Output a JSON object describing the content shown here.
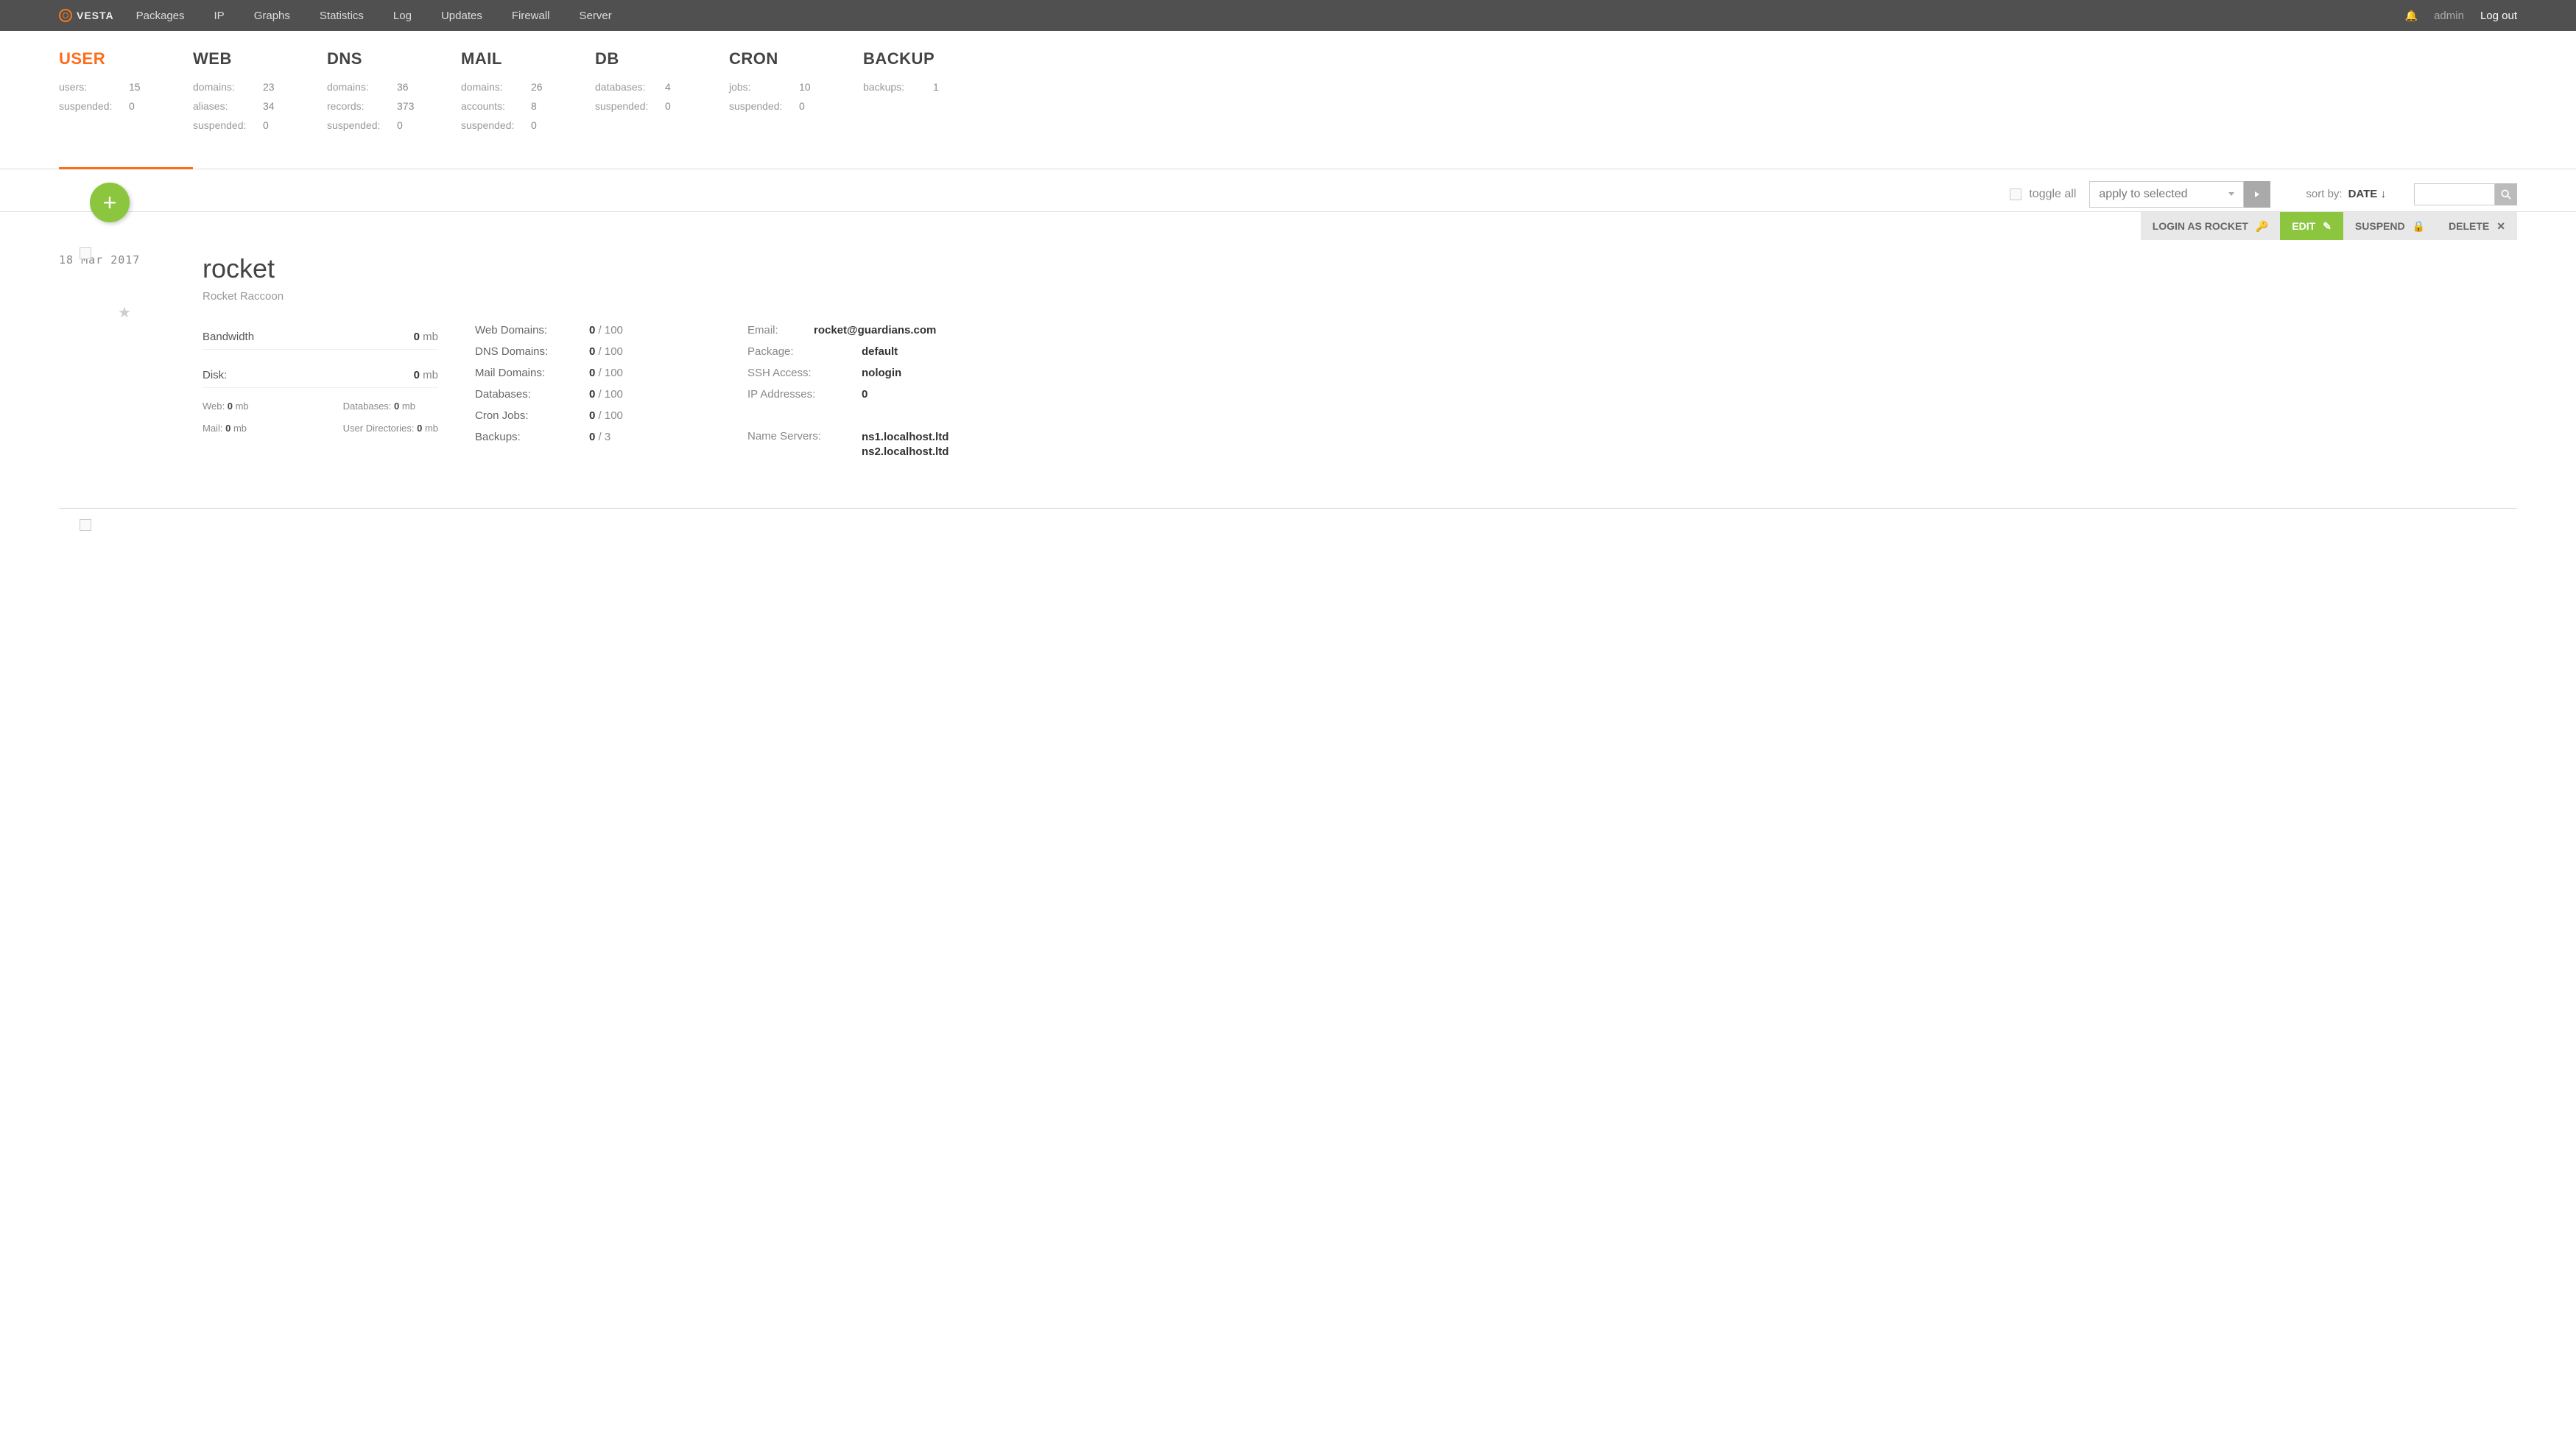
{
  "brand": "VESTA",
  "topnav": [
    "Packages",
    "IP",
    "Graphs",
    "Statistics",
    "Log",
    "Updates",
    "Firewall",
    "Server"
  ],
  "topright": {
    "admin": "admin",
    "logout": "Log out"
  },
  "tabs": [
    {
      "title": "USER",
      "lines": [
        [
          "users:",
          "15"
        ],
        [
          "suspended:",
          "0"
        ]
      ]
    },
    {
      "title": "WEB",
      "lines": [
        [
          "domains:",
          "23"
        ],
        [
          "aliases:",
          "34"
        ],
        [
          "suspended:",
          "0"
        ]
      ]
    },
    {
      "title": "DNS",
      "lines": [
        [
          "domains:",
          "36"
        ],
        [
          "records:",
          "373"
        ],
        [
          "suspended:",
          "0"
        ]
      ]
    },
    {
      "title": "MAIL",
      "lines": [
        [
          "domains:",
          "26"
        ],
        [
          "accounts:",
          "8"
        ],
        [
          "suspended:",
          "0"
        ]
      ]
    },
    {
      "title": "DB",
      "lines": [
        [
          "databases:",
          "4"
        ],
        [
          "suspended:",
          "0"
        ]
      ]
    },
    {
      "title": "CRON",
      "lines": [
        [
          "jobs:",
          "10"
        ],
        [
          "suspended:",
          "0"
        ]
      ]
    },
    {
      "title": "BACKUP",
      "lines": [
        [
          "backups:",
          "1"
        ]
      ]
    }
  ],
  "toolbar": {
    "toggle_all": "toggle all",
    "apply_to_selected": "apply to selected",
    "sortby_label": "sort by:",
    "sortby_field": "DATE",
    "sortby_dir": "↓"
  },
  "actions": {
    "login_as": "LOGIN AS ROCKET",
    "edit": "EDIT",
    "suspend": "SUSPEND",
    "delete": "DELETE"
  },
  "user": {
    "date": "18 Mar 2017",
    "username": "rocket",
    "fullname": "Rocket Raccoon",
    "usage": {
      "bandwidth_label": "Bandwidth",
      "bandwidth_val": "0",
      "bandwidth_unit": "mb",
      "disk_label": "Disk:",
      "disk_val": "0",
      "disk_unit": "mb",
      "sub": {
        "web_label": "Web:",
        "web_val": "0",
        "web_unit": "mb",
        "databases_label": "Databases:",
        "databases_val": "0",
        "databases_unit": "mb",
        "mail_label": "Mail:",
        "mail_val": "0",
        "mail_unit": "mb",
        "userdir_label": "User Directories:",
        "userdir_val": "0",
        "userdir_unit": "mb"
      }
    },
    "limits": [
      [
        "Web Domains:",
        "0",
        "100"
      ],
      [
        "DNS Domains:",
        "0",
        "100"
      ],
      [
        "Mail Domains:",
        "0",
        "100"
      ],
      [
        "Databases:",
        "0",
        "100"
      ],
      [
        "Cron Jobs:",
        "0",
        "100"
      ],
      [
        "Backups:",
        "0",
        "3"
      ]
    ],
    "info": {
      "email_label": "Email:",
      "email_val": "rocket@guardians.com",
      "package_label": "Package:",
      "package_val": "default",
      "ssh_label": "SSH Access:",
      "ssh_val": "nologin",
      "ip_label": "IP Addresses:",
      "ip_val": "0",
      "ns_label": "Name Servers:",
      "ns_val": "ns1.localhost.ltd\nns2.localhost.ltd"
    }
  }
}
